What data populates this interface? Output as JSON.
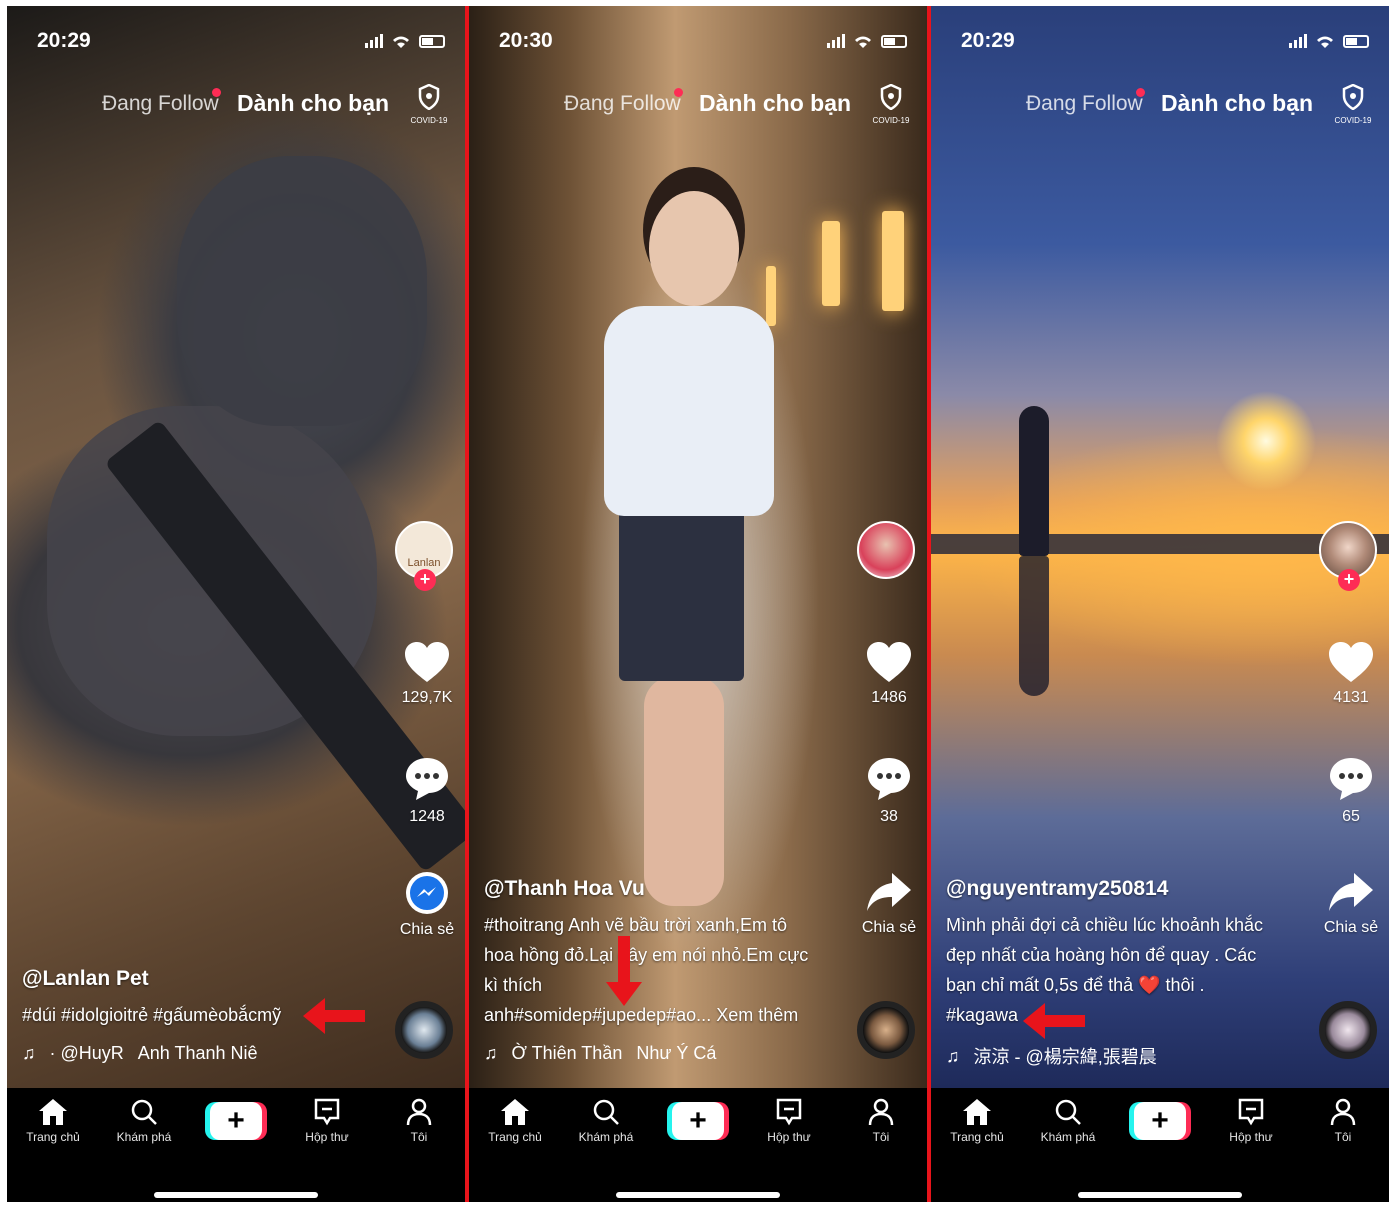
{
  "colors": {
    "accent": "#fe2c55",
    "divider": "#e8141b",
    "cyan": "#25f4ee"
  },
  "icons": [
    "signal-icon",
    "wifi-icon",
    "battery-icon",
    "shield-icon",
    "heart-icon",
    "comment-icon",
    "messenger-icon",
    "share-icon",
    "music-note-icon",
    "home-icon",
    "search-icon",
    "plus-icon",
    "inbox-icon",
    "profile-icon",
    "red-arrow-icon"
  ],
  "phones": [
    {
      "time": "20:29",
      "nav": {
        "following": "Đang Follow",
        "for_you": "Dành cho bạn",
        "covid": "COVID-19"
      },
      "likes": "129,7K",
      "comments": "1248",
      "share": "Chia sẻ",
      "avatar_text": "Lanlan",
      "username": "@Lanlan Pet",
      "caption_lines": [
        "#dúi #idolgioitrẻ #gấumèobắcmỹ"
      ],
      "music": [
        "· @HuyR",
        "Anh Thanh Niê"
      ]
    },
    {
      "time": "20:30",
      "nav": {
        "following": "Đang Follow",
        "for_you": "Dành cho bạn",
        "covid": "COVID-19"
      },
      "likes": "1486",
      "comments": "38",
      "share": "Chia sẻ",
      "username": "@Thanh Hoa Vu",
      "caption_lines": [
        "#thoitrang Anh vẽ bầu trời xanh,Em tô",
        "hoa hồng đỏ.Lại đây em nói nhỏ.Em cực",
        "kì thích",
        "anh#somidep#jupedep#ao... Xem thêm"
      ],
      "music": [
        "Ờ Thiên Thần",
        "Như Ý Cá"
      ]
    },
    {
      "time": "20:29",
      "nav": {
        "following": "Đang Follow",
        "for_you": "Dành cho bạn",
        "covid": "COVID-19"
      },
      "likes": "4131",
      "comments": "65",
      "share": "Chia sẻ",
      "username": "@nguyentramy250814",
      "caption_lines": [
        "Mình phải đợi cả chiều lúc khoảnh khắc",
        "đẹp nhất của hoàng hôn để quay . Các",
        "bạn chỉ mất 0,5s để thả ❤️ thôi .",
        "#kagawa"
      ],
      "music": [
        "涼涼 - @楊宗緯,張碧晨"
      ]
    }
  ],
  "tabs": [
    "Trang chủ",
    "Khám phá",
    "+",
    "Hộp thư",
    "Tôi"
  ]
}
